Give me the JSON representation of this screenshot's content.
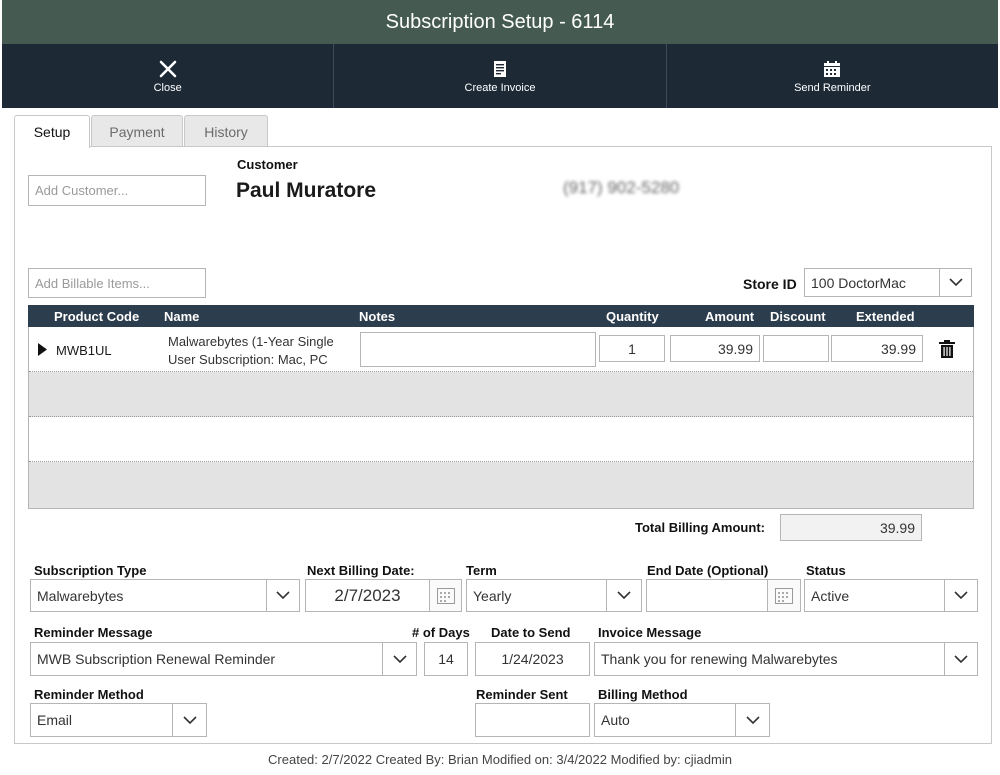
{
  "window": {
    "title": "Subscription Setup - 6114"
  },
  "toolbar": {
    "close": "Close",
    "create_invoice": "Create Invoice",
    "send_reminder": "Send Reminder"
  },
  "tabs": [
    {
      "label": "Setup",
      "active": true
    },
    {
      "label": "Payment",
      "active": false
    },
    {
      "label": "History",
      "active": false
    }
  ],
  "customer": {
    "add_placeholder": "Add Customer...",
    "label": "Customer",
    "name": "Paul Muratore",
    "phone": "(917) 902-5280"
  },
  "billable": {
    "add_placeholder": "Add Billable Items..."
  },
  "store": {
    "label": "Store ID",
    "value": "100 DoctorMac"
  },
  "table": {
    "columns": [
      "Product Code",
      "Name",
      "Notes",
      "Quantity",
      "Amount",
      "Discount",
      "Extended"
    ],
    "rows": [
      {
        "product_code": "MWB1UL",
        "name_line1": "Malwarebytes (1-Year Single",
        "name_line2": "User Subscription: Mac, PC",
        "notes": "",
        "quantity": "1",
        "amount": "39.99",
        "discount": "",
        "extended": "39.99"
      }
    ]
  },
  "total": {
    "label": "Total Billing Amount:",
    "value": "39.99"
  },
  "form": {
    "subscription_type": {
      "label": "Subscription Type",
      "value": "Malwarebytes"
    },
    "next_billing_date": {
      "label": "Next Billing Date:",
      "value": "2/7/2023"
    },
    "term": {
      "label": "Term",
      "value": "Yearly"
    },
    "end_date": {
      "label": "End Date (Optional)",
      "value": ""
    },
    "status": {
      "label": "Status",
      "value": "Active"
    },
    "reminder_message": {
      "label": "Reminder Message",
      "value": "MWB Subscription Renewal Reminder"
    },
    "num_days": {
      "label": "# of Days",
      "value": "14"
    },
    "date_to_send": {
      "label": "Date to Send",
      "value": "1/24/2023"
    },
    "invoice_message": {
      "label": "Invoice Message",
      "value": "Thank you for renewing Malwarebytes"
    },
    "reminder_method": {
      "label": "Reminder Method",
      "value": "Email"
    },
    "reminder_sent": {
      "label": "Reminder Sent",
      "value": ""
    },
    "billing_method": {
      "label": "Billing Method",
      "value": "Auto"
    }
  },
  "footer": {
    "text": "Created: 2/7/2022 Created By: Brian Modified on: 3/4/2022 Modified by: cjiadmin"
  },
  "colors": {
    "titlebar": "#455b52",
    "toolbar": "#1d2a36",
    "table_header": "#2c3d4e",
    "row_alt": "#e3e3e3"
  }
}
